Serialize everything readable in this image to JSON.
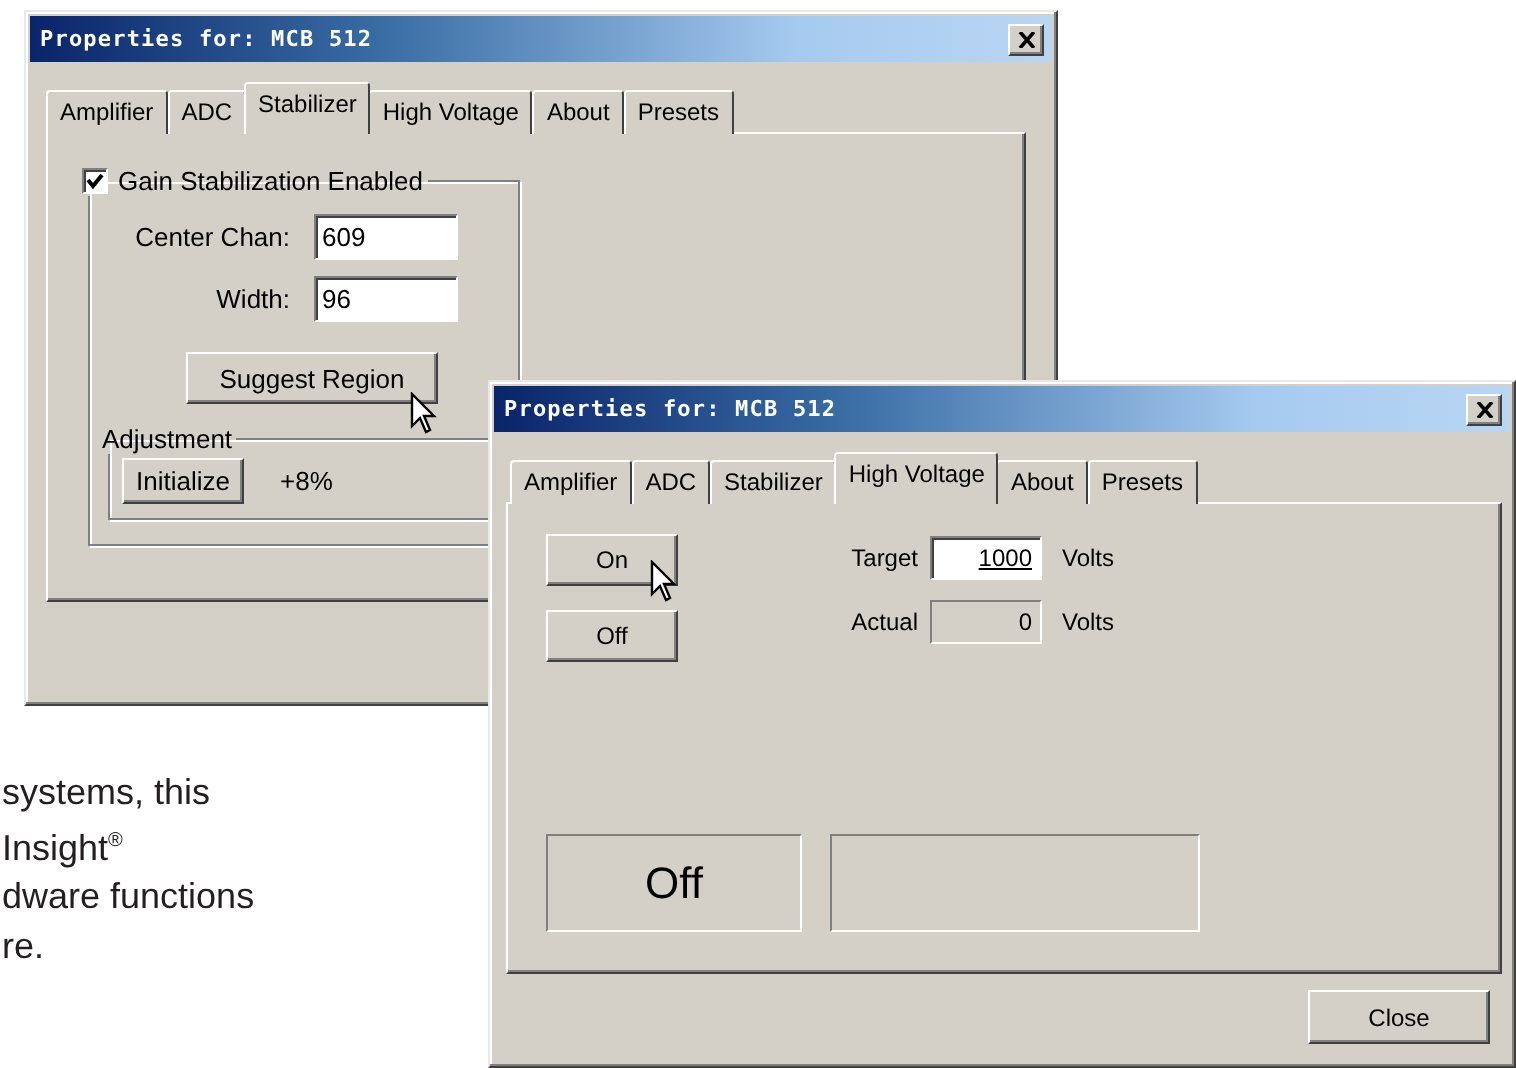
{
  "document_text": {
    "lines": [
      "systems, this",
      "Insight$^{®}$",
      "dware functions",
      "re."
    ]
  },
  "back_window": {
    "title": "Properties for: MCB 512",
    "tabs": [
      {
        "label": "Amplifier",
        "selected": false
      },
      {
        "label": "ADC",
        "selected": false
      },
      {
        "label": "Stabilizer",
        "selected": true
      },
      {
        "label": "High Voltage",
        "selected": false
      },
      {
        "label": "About",
        "selected": false
      },
      {
        "label": "Presets",
        "selected": false
      }
    ],
    "gain_group": {
      "label": "Gain Stabilization Enabled",
      "checked": true
    },
    "fields": [
      {
        "label": "Center Chan:",
        "value": "609"
      },
      {
        "label": "Width:",
        "value": "96"
      }
    ],
    "suggest_button": "Suggest Region",
    "adjustment": {
      "label": "Adjustment",
      "button": "Initialize",
      "reading": "+8%"
    }
  },
  "front_window": {
    "title": "Properties for: MCB 512",
    "tabs": [
      {
        "label": "Amplifier",
        "selected": false
      },
      {
        "label": "ADC",
        "selected": false
      },
      {
        "label": "Stabilizer",
        "selected": false
      },
      {
        "label": "High Voltage",
        "selected": true
      },
      {
        "label": "About",
        "selected": false
      },
      {
        "label": "Presets",
        "selected": false
      }
    ],
    "buttons": [
      "On",
      "Off"
    ],
    "readouts": [
      {
        "label": "Target",
        "value": "1000",
        "unit": "Volts",
        "editable": true
      },
      {
        "label": "Actual",
        "value": "0",
        "unit": "Volts",
        "editable": false
      }
    ],
    "status": "Off",
    "close_button": "Close"
  }
}
